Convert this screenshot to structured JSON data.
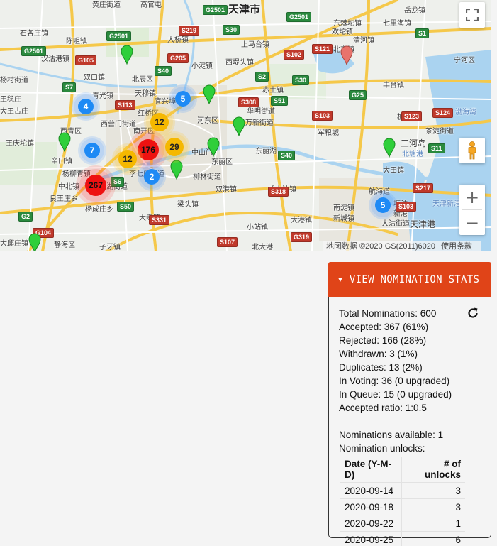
{
  "map": {
    "city_label": "天津市",
    "place_labels": [
      "黄庄街道",
      "高官屯",
      "石各庄镇",
      "陈咀镇",
      "汉沽港镇",
      "双口镇",
      "上马台镇",
      "王稳庄",
      "北辰区",
      "大桥镇",
      "西堤头镇",
      "小淀镇",
      "赤土镇",
      "华明街道",
      "杨村街道",
      "大王古庄",
      "王庆坨镇",
      "青光镇",
      "天穆镇",
      "宜兴埠镇",
      "西青区",
      "西营门街道",
      "红桥区",
      "南开区",
      "河东区",
      "东丽区",
      "万新街道",
      "中山门",
      "东丽湖",
      "辛口镇",
      "杨柳青镇",
      "津门湖街道",
      "中北镇",
      "李七庄街道",
      "柳林街道",
      "双港镇",
      "大寺镇",
      "良王庄乡",
      "静海区",
      "大邱庄镇",
      "子牙镇",
      "梁头镇",
      "北大港",
      "杨成庄乡",
      "小站镇",
      "大港镇",
      "咸水沽镇",
      "军粮城",
      "新城镇",
      "三河岛",
      "北塘港",
      "航海道",
      "渤海湾",
      "新港",
      "塘沽",
      "天津港",
      "大沽街道",
      "北京镇",
      "清河镇",
      "欢坨镇",
      "宁河区",
      "东棘坨镇",
      "岳龙镇",
      "七里海镇",
      "丰台镇",
      "板桥镇",
      "茶淀街道",
      "大田镇",
      "南淀镇",
      "天津新港"
    ],
    "route_shields": [
      {
        "text": "G2501",
        "color": "green"
      },
      {
        "text": "G2501",
        "color": "green"
      },
      {
        "text": "G2501",
        "color": "green"
      },
      {
        "text": "G2501",
        "color": "green"
      },
      {
        "text": "S30",
        "color": "green"
      },
      {
        "text": "S40",
        "color": "green"
      },
      {
        "text": "S2",
        "color": "green"
      },
      {
        "text": "S1",
        "color": "green"
      },
      {
        "text": "S30",
        "color": "green"
      },
      {
        "text": "S51",
        "color": "green"
      },
      {
        "text": "S40",
        "color": "green"
      },
      {
        "text": "S11",
        "color": "green"
      },
      {
        "text": "G25",
        "color": "green"
      },
      {
        "text": "G2",
        "color": "green"
      },
      {
        "text": "S7",
        "color": "green"
      },
      {
        "text": "S50",
        "color": "green"
      },
      {
        "text": "S6",
        "color": "green"
      },
      {
        "text": "G205",
        "color": "red"
      },
      {
        "text": "S219",
        "color": "red"
      },
      {
        "text": "S102",
        "color": "red"
      },
      {
        "text": "S121",
        "color": "red"
      },
      {
        "text": "G105",
        "color": "red"
      },
      {
        "text": "S113",
        "color": "red"
      },
      {
        "text": "S308",
        "color": "red"
      },
      {
        "text": "S103",
        "color": "red"
      },
      {
        "text": "S123",
        "color": "red"
      },
      {
        "text": "S217",
        "color": "red"
      },
      {
        "text": "S318",
        "color": "red"
      },
      {
        "text": "S331",
        "color": "red"
      },
      {
        "text": "G104",
        "color": "red"
      },
      {
        "text": "S107",
        "color": "red"
      },
      {
        "text": "G319",
        "color": "red"
      },
      {
        "text": "S124",
        "color": "red"
      },
      {
        "text": "S103",
        "color": "red"
      }
    ],
    "clusters": [
      {
        "count": "4",
        "color": "blue"
      },
      {
        "count": "5",
        "color": "blue"
      },
      {
        "count": "12",
        "color": "yellow"
      },
      {
        "count": "7",
        "color": "blue"
      },
      {
        "count": "176",
        "color": "red"
      },
      {
        "count": "29",
        "color": "yellow"
      },
      {
        "count": "12",
        "color": "yellow"
      },
      {
        "count": "2",
        "color": "blue"
      },
      {
        "count": "267",
        "color": "red"
      },
      {
        "count": "5",
        "color": "blue"
      }
    ],
    "pins": {
      "accepted_color": "#2fcf3a",
      "rejected_color": "#e8736c"
    },
    "attribution": {
      "data": "地图数据 ©2020 GS(2011)6020",
      "terms": "使用条款"
    },
    "controls": {
      "zoom_in": "+",
      "zoom_out": "−"
    }
  },
  "stats": {
    "toggle_label": "VIEW NOMINATION STATS",
    "lines": [
      "Total Nominations: 600",
      "Accepted: 367 (61%)",
      "Rejected: 166 (28%)",
      "Withdrawn: 3 (1%)",
      "Duplicates: 13 (2%)",
      "In Voting: 36 (0 upgraded)",
      "In Queue: 15 (0 upgraded)",
      "Accepted ratio: 1:0.5"
    ],
    "available": "Nominations available: 1",
    "unlocks_title": "Nomination unlocks:",
    "table": {
      "headers": [
        "Date (Y-M-D)",
        "# of unlocks"
      ],
      "rows": [
        [
          "2020-09-14",
          "3"
        ],
        [
          "2020-09-18",
          "3"
        ],
        [
          "2020-09-22",
          "1"
        ],
        [
          "2020-09-25",
          "6"
        ]
      ]
    }
  },
  "colors": {
    "accent": "#e04418",
    "map_bg": "#eef0ec",
    "highway": "#f5c84a",
    "water": "#aad3f0"
  }
}
